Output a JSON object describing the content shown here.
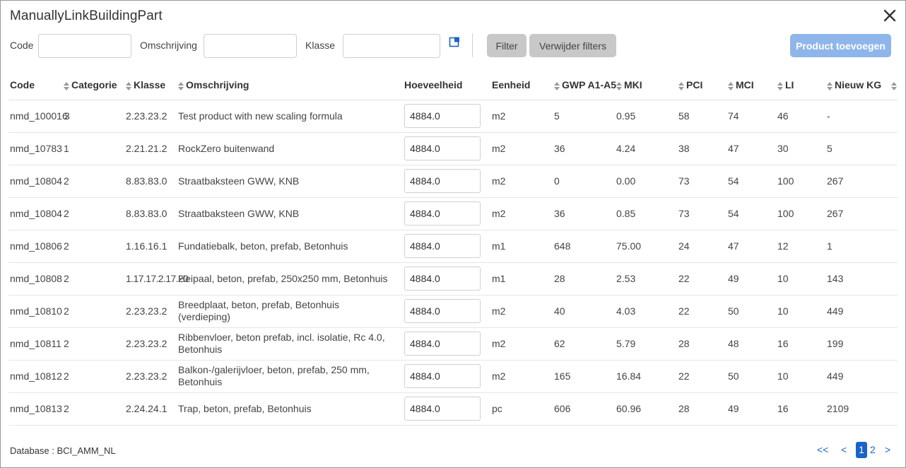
{
  "dialog": {
    "title": "ManuallyLinkBuildingPart"
  },
  "filters": {
    "code_label": "Code",
    "code_value": "",
    "omschrijving_label": "Omschrijving",
    "omschrijving_value": "",
    "klasse_label": "Klasse",
    "klasse_value": ""
  },
  "buttons": {
    "filter": "Filter",
    "clear_filters": "Verwijder filters",
    "add_product": "Product toevoegen"
  },
  "table": {
    "headers": {
      "code": "Code",
      "categorie": "Categorie",
      "klasse": "Klasse",
      "omschrijving": "Omschrijving",
      "hoeveelheid": "Hoeveelheid",
      "eenheid": "Eenheid",
      "gwp": "GWP A1-A5",
      "mki": "MKI",
      "pci": "PCI",
      "mci": "MCI",
      "li": "LI",
      "nieuw_kg": "Nieuw KG"
    },
    "rows": [
      {
        "code": "nmd_100016",
        "categorie": "3",
        "klasse": "2.23.23.2",
        "omschrijving": "Test product with new scaling formula",
        "hoeveelheid": "4884.0",
        "eenheid": "m2",
        "gwp": "5",
        "mki": "0.95",
        "pci": "58",
        "mci": "74",
        "li": "46",
        "nieuw_kg": "-"
      },
      {
        "code": "nmd_10783",
        "categorie": "1",
        "klasse": "2.21.21.2",
        "omschrijving": "RockZero buitenwand",
        "hoeveelheid": "4884.0",
        "eenheid": "m2",
        "gwp": "36",
        "mki": "4.24",
        "pci": "38",
        "mci": "47",
        "li": "30",
        "nieuw_kg": "5"
      },
      {
        "code": "nmd_10804",
        "categorie": "2",
        "klasse": "8.83.83.0",
        "omschrijving": "Straatbaksteen GWW, KNB",
        "hoeveelheid": "4884.0",
        "eenheid": "m2",
        "gwp": "0",
        "mki": "0.00",
        "pci": "73",
        "mci": "54",
        "li": "100",
        "nieuw_kg": "267"
      },
      {
        "code": "nmd_10804",
        "categorie": "2",
        "klasse": "8.83.83.0",
        "omschrijving": "Straatbaksteen GWW, KNB",
        "hoeveelheid": "4884.0",
        "eenheid": "m2",
        "gwp": "36",
        "mki": "0.85",
        "pci": "73",
        "mci": "54",
        "li": "100",
        "nieuw_kg": "267"
      },
      {
        "code": "nmd_10806",
        "categorie": "2",
        "klasse": "1.16.16.1",
        "omschrijving": "Fundatiebalk, beton, prefab, Betonhuis",
        "hoeveelheid": "4884.0",
        "eenheid": "m1",
        "gwp": "648",
        "mki": "75.00",
        "pci": "24",
        "mci": "47",
        "li": "12",
        "nieuw_kg": "1"
      },
      {
        "code": "nmd_10808",
        "categorie": "2",
        "klasse": "1.17.17.2.17.20",
        "omschrijving": "Heipaal, beton, prefab, 250x250 mm, Betonhuis",
        "hoeveelheid": "4884.0",
        "eenheid": "m1",
        "gwp": "28",
        "mki": "2.53",
        "pci": "22",
        "mci": "49",
        "li": "10",
        "nieuw_kg": "143"
      },
      {
        "code": "nmd_10810",
        "categorie": "2",
        "klasse": "2.23.23.2",
        "omschrijving": "Breedplaat, beton, prefab, Betonhuis (verdieping)",
        "hoeveelheid": "4884.0",
        "eenheid": "m2",
        "gwp": "40",
        "mki": "4.03",
        "pci": "22",
        "mci": "50",
        "li": "10",
        "nieuw_kg": "449"
      },
      {
        "code": "nmd_10811",
        "categorie": "2",
        "klasse": "2.23.23.2",
        "omschrijving": "Ribbenvloer, beton prefab, incl. isolatie, Rc 4.0, Betonhuis",
        "hoeveelheid": "4884.0",
        "eenheid": "m2",
        "gwp": "62",
        "mki": "5.79",
        "pci": "28",
        "mci": "48",
        "li": "16",
        "nieuw_kg": "199"
      },
      {
        "code": "nmd_10812",
        "categorie": "2",
        "klasse": "2.23.23.2",
        "omschrijving": "Balkon-/galerijvloer, beton, prefab, 250 mm, Betonhuis",
        "hoeveelheid": "4884.0",
        "eenheid": "m2",
        "gwp": "165",
        "mki": "16.84",
        "pci": "22",
        "mci": "50",
        "li": "10",
        "nieuw_kg": "449"
      },
      {
        "code": "nmd_10813",
        "categorie": "2",
        "klasse": "2.24.24.1",
        "omschrijving": "Trap, beton, prefab, Betonhuis",
        "hoeveelheid": "4884.0",
        "eenheid": "pc",
        "gwp": "606",
        "mki": "60.96",
        "pci": "28",
        "mci": "49",
        "li": "16",
        "nieuw_kg": "2109"
      }
    ]
  },
  "footer": {
    "database": "Database : BCI_AMM_NL",
    "pager_first": "<<",
    "pager_prev": "<",
    "pages": [
      "1",
      "2"
    ],
    "current_page": "1",
    "pager_next": ">"
  },
  "colors": {
    "accent": "#1a63c7",
    "add_button": "#8fb6ea",
    "gray_button": "#c8c8c8"
  },
  "icons": {
    "close": "close-icon",
    "popout": "external-window-icon",
    "sort": "sort-arrows-icon"
  }
}
